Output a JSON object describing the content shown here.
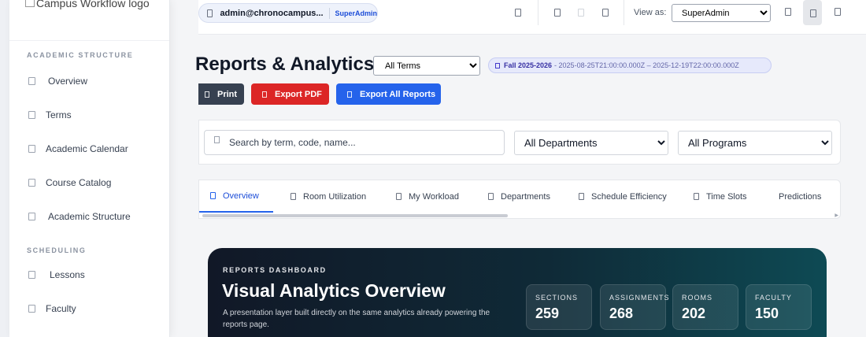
{
  "sidebar": {
    "logo_alt": "Campus Workflow logo",
    "sections": [
      {
        "title": "ACADEMIC STRUCTURE",
        "items": [
          {
            "label": "Overview"
          },
          {
            "label": "Terms"
          },
          {
            "label": "Academic Calendar"
          },
          {
            "label": "Course Catalog"
          },
          {
            "label": "Academic Structure"
          }
        ]
      },
      {
        "title": "SCHEDULING",
        "items": [
          {
            "label": "Lessons"
          },
          {
            "label": "Faculty"
          }
        ]
      }
    ]
  },
  "topbar": {
    "user_email": "admin@chronocampus...",
    "user_role": "SuperAdmin",
    "view_as_label": "View as:",
    "view_as_value": "SuperAdmin"
  },
  "header": {
    "title": "Reports & Analytics",
    "term_select": "All Terms",
    "term_badge": {
      "name": "Fall 2025-2026",
      "range": "- 2025-08-25T21:00:00.000Z – 2025-12-19T22:00:00.000Z"
    },
    "buttons": {
      "print": "Print",
      "export_pdf": "Export PDF",
      "export_all": "Export All Reports"
    }
  },
  "filters": {
    "search_placeholder": "Search by term, code, name...",
    "department": "All Departments",
    "program": "All Programs"
  },
  "tabs": [
    {
      "label": "Overview",
      "active": true
    },
    {
      "label": "Room Utilization"
    },
    {
      "label": "My Workload"
    },
    {
      "label": "Departments"
    },
    {
      "label": "Schedule Efficiency"
    },
    {
      "label": "Time Slots"
    },
    {
      "label": "Predictions"
    }
  ],
  "hero": {
    "kicker": "REPORTS DASHBOARD",
    "title": "Visual Analytics Overview",
    "description": "A presentation layer built directly on the same analytics already powering the reports page.",
    "stats": [
      {
        "label": "SECTIONS",
        "value": "259"
      },
      {
        "label": "ASSIGNMENTS",
        "value": "268"
      },
      {
        "label": "ROOMS",
        "value": "202"
      },
      {
        "label": "FACULTY",
        "value": "150"
      }
    ]
  }
}
